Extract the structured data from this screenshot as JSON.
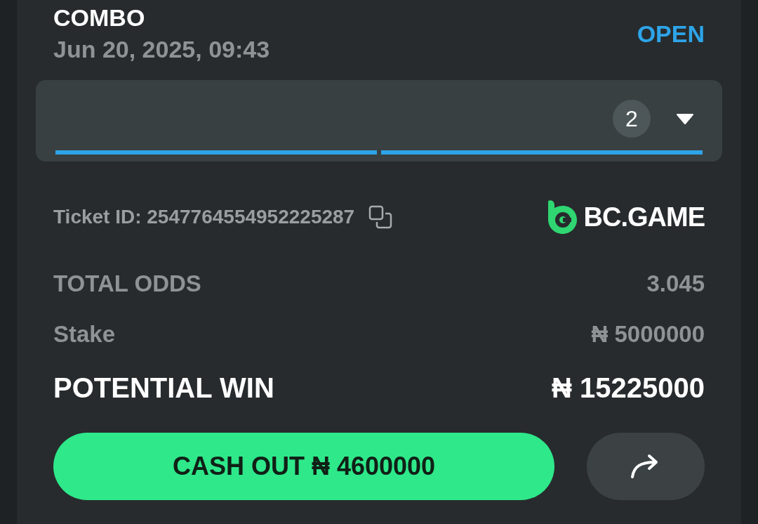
{
  "header": {
    "title": "COMBO",
    "date": "Jun 20, 2025, 09:43",
    "status": "OPEN"
  },
  "legs_panel": {
    "count": "2",
    "expanded": false,
    "segments": [
      {
        "level": 1
      },
      {
        "level": 1
      }
    ]
  },
  "ticket": {
    "label": "Ticket ID: 2547764554952225287",
    "brand": "BC.GAME"
  },
  "summary": [
    {
      "label": "TOTAL ODDS",
      "value": "3.045",
      "kind": "minor"
    },
    {
      "label": "Stake",
      "value": "₦ 5000000",
      "kind": "minor"
    },
    {
      "label": "POTENTIAL WIN",
      "value": "₦ 15225000",
      "kind": "major"
    }
  ],
  "actions": {
    "cash_out": "CASH OUT ₦ 4600000"
  }
}
